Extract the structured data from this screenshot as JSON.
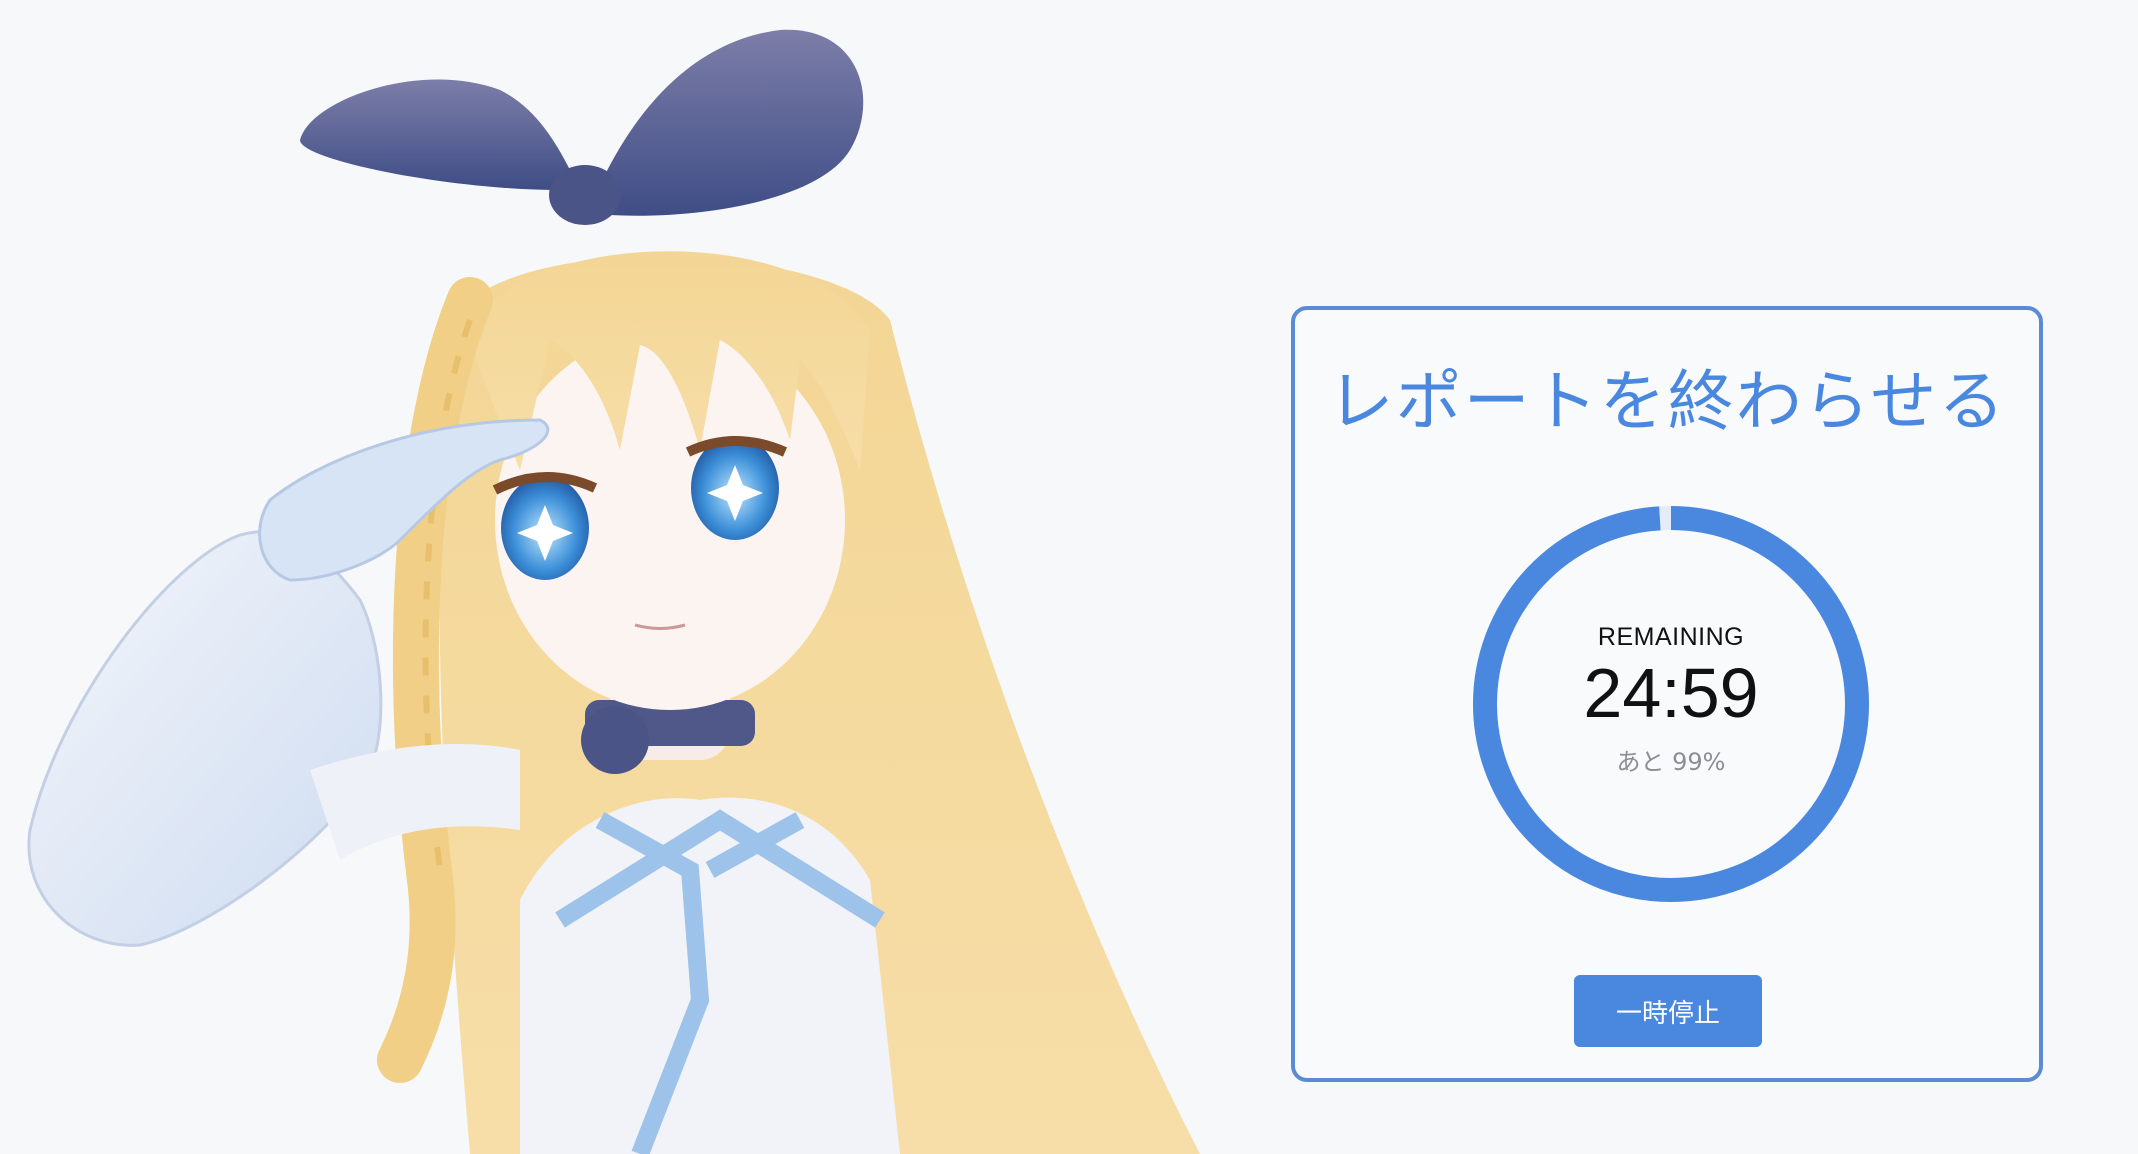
{
  "timer": {
    "title": "レポートを終わらせる",
    "remaining_label": "REMAINING",
    "time": "24:59",
    "percent_text": "あと 99%",
    "progress_fraction": 0.99,
    "pause_label": "一時停止"
  },
  "colors": {
    "accent": "#4a88e0",
    "border": "#5b8bd4",
    "background": "#f7f8fa"
  },
  "avatar": {
    "description_icon": "anime-girl-avatar-icon"
  }
}
